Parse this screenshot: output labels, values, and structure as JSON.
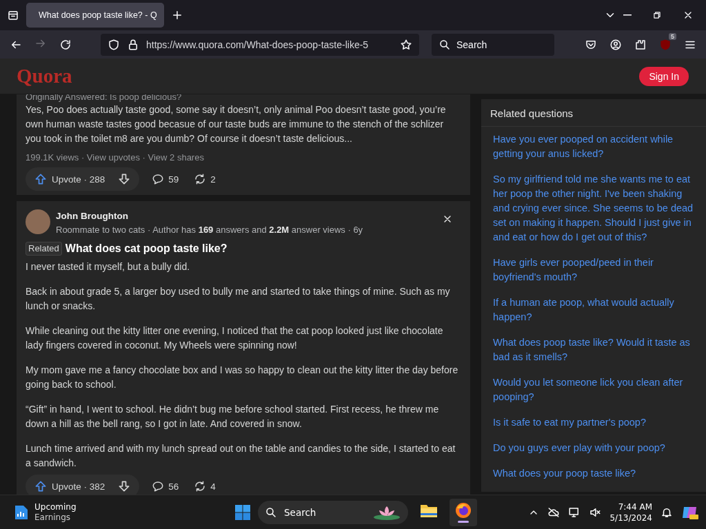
{
  "browser": {
    "tabs": [
      {
        "title": "What does poop taste like? - Q",
        "selected": true
      }
    ],
    "url": "https://www.quora.com/What-does-poop-taste-like-5",
    "search_placeholder": "Search",
    "extension_badge": "5"
  },
  "site": {
    "logo": "Quora",
    "sign_in": "Sign In"
  },
  "answers": [
    {
      "kind": "excerpt",
      "originally_answered": "Originally Answered: Is poop delicious?",
      "body": [
        "Yes, Poo does actually taste good, some say it doesn’t, only animal Poo doesn’t taste good, you’re own human waste tastes good becasue of our taste buds are immune to the stench of the schlizer you took in the toilet m8 are you dumb? Of course it doesn’t taste delicious..."
      ],
      "stats": "199.1K views · View upvotes · View 2 shares",
      "upvotes": "Upvote · 288",
      "comments": "59",
      "shares": "2"
    },
    {
      "kind": "full",
      "author": "John Broughton",
      "credential": "Roommate to two cats · Author has **169** answers and **2.2M** answer views · 6y",
      "tag": "Related",
      "question": "What does cat poop taste like?",
      "body": [
        "I never tasted it myself, but a bully did.",
        "Back in about grade 5, a larger boy used to bully me and started to take things of mine. Such as my lunch or snacks.",
        "While cleaning out the kitty litter one evening, I noticed that the cat poop looked just like chocolate lady fingers covered in coconut. My Wheels were spinning now!",
        "My mom gave me a fancy chocolate box and I was so happy to clean out the kitty litter the day before going back to school.",
        "“Gift” in hand, I went to school. He didn’t bug me before school started. First recess, he threw me down a hill as the bell rang, so I got in late. And covered in snow.",
        "Lunch time arrived and with my lunch spread out on the table and candies to the side, I started to eat a sandwich."
      ],
      "upvotes": "Upvote · 382",
      "comments": "56",
      "shares": "4"
    }
  ],
  "related": {
    "title": "Related questions",
    "questions": [
      "Have you ever pooped on accident while getting your anus licked?",
      "So my girlfriend told me she wants me to eat her poop the other night. I've been shaking and crying ever since. She seems to be dead set on making it happen. Should I just give in and eat or how do I get out of this?",
      "Have girls ever pooped/peed in their boyfriend's mouth?",
      "If a human ate poop, what would actually happen?",
      "What does poop taste like? Would it taste as bad as it smells?",
      "Would you let someone lick you clean after pooping?",
      "Is it safe to eat my partner's poop?",
      "Do you guys ever play with your poop?",
      "What does your poop taste like?"
    ]
  },
  "taskbar": {
    "widget": {
      "title": "Upcoming",
      "subtitle": "Earnings"
    },
    "search_placeholder": "Search",
    "apps": [
      {
        "kind": "explorer",
        "selected": false
      },
      {
        "kind": "firefox",
        "selected": true
      }
    ],
    "time": "7:44 AM",
    "date": "5/13/2024"
  }
}
